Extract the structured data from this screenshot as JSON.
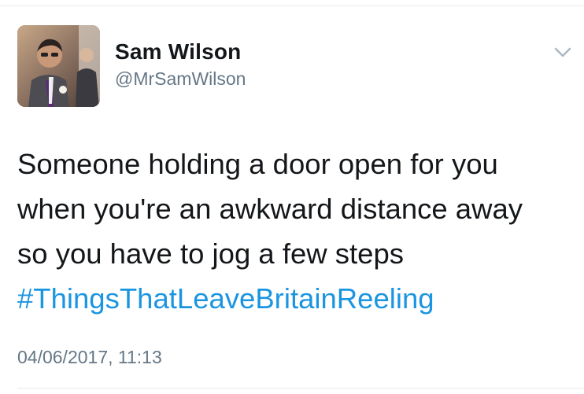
{
  "tweet": {
    "author": {
      "name": "Sam Wilson",
      "handle": "@MrSamWilson"
    },
    "menu_icon": "chevron-down-icon",
    "text_lines": [
      "Someone holding a door open for you",
      "when you're an awkward distance away",
      "so you have to jog a few steps"
    ],
    "hashtag": "#ThingsThatLeaveBritainReeling",
    "timestamp": "04/06/2017, 11:13"
  },
  "colors": {
    "text": "#14171a",
    "secondary_text": "#657786",
    "link": "#1b95e0",
    "divider": "#e1e8ed"
  }
}
